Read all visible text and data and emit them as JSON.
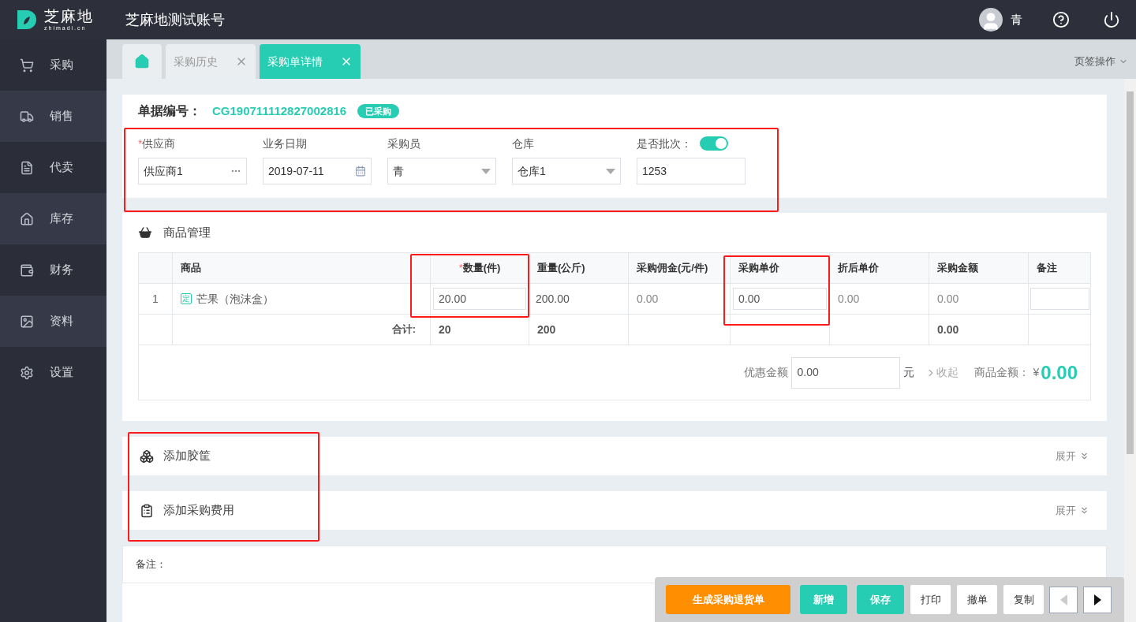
{
  "logo": {
    "name": "芝麻地",
    "domain": "zhimadi.cn"
  },
  "header": {
    "account": "芝麻地测试账号",
    "user": "青"
  },
  "sidebar": {
    "items": [
      {
        "label": "采购"
      },
      {
        "label": "销售"
      },
      {
        "label": "代卖"
      },
      {
        "label": "库存"
      },
      {
        "label": "财务"
      },
      {
        "label": "资料"
      },
      {
        "label": "设置"
      }
    ]
  },
  "tabs": [
    {
      "kind": "home",
      "selected": false
    },
    {
      "kind": "page",
      "label": "采购历史",
      "selected": false
    },
    {
      "kind": "page",
      "label": "采购单详情",
      "selected": true
    }
  ],
  "tab_actions": "页签操作",
  "document": {
    "label": "单据编号：",
    "number": "CG190711112827002816",
    "status": "已采购"
  },
  "fields": [
    {
      "marker": "*",
      "label": "供应商",
      "value": "供应商1",
      "kind": "picker"
    },
    {
      "label": "业务日期",
      "value": "2019-07-11",
      "kind": "date"
    },
    {
      "label": "采购员",
      "value": "青",
      "kind": "select"
    },
    {
      "label": "仓库",
      "value": "仓库1",
      "kind": "select"
    },
    {
      "label": "是否批次：",
      "value": "1253",
      "kind": "toggle",
      "on": true
    }
  ],
  "goods": {
    "title": "商品管理",
    "columns": [
      {},
      {
        "label": "商品"
      },
      {
        "marker": "*",
        "label": "数量(件)"
      },
      {
        "label": "重量(公斤)"
      },
      {
        "label": "采购佣金(元/件)"
      },
      {
        "label": "采购单价"
      },
      {
        "label": "折后单价"
      },
      {
        "label": "采购金额"
      },
      {
        "label": "备注"
      }
    ],
    "rows": [
      {
        "index": "1",
        "tag": "定",
        "name": "芒果（泡沫盒）",
        "quantity": "20.00",
        "weight": "200.00",
        "commission": "0.00",
        "unit_price": "0.00",
        "discount_price": "0.00",
        "amount": "0.00"
      }
    ],
    "total": {
      "label": "合计:",
      "quantity": "20",
      "weight": "200",
      "amount": "0.00"
    },
    "discount_label": "优惠金额",
    "discount_value": "0.00",
    "unit": "元",
    "collapse": "收起",
    "goods_amount_label": "商品金额：",
    "currency": "¥",
    "goods_amount": "0.00"
  },
  "sections": [
    {
      "title": "添加胶筐",
      "action": "展开"
    },
    {
      "title": "添加采购费用",
      "action": "展开"
    }
  ],
  "remark_label": "备注：",
  "actions": [
    {
      "label": "生成采购退货单",
      "kind": "warning"
    },
    {
      "label": "新增",
      "kind": "primary"
    },
    {
      "label": "保存",
      "kind": "primary"
    },
    {
      "label": "打印",
      "kind": "plain"
    },
    {
      "label": "撤单",
      "kind": "plain"
    },
    {
      "label": "复制",
      "kind": "plain"
    },
    {
      "kind": "prev",
      "disabled": true
    },
    {
      "kind": "next",
      "disabled": false
    }
  ]
}
